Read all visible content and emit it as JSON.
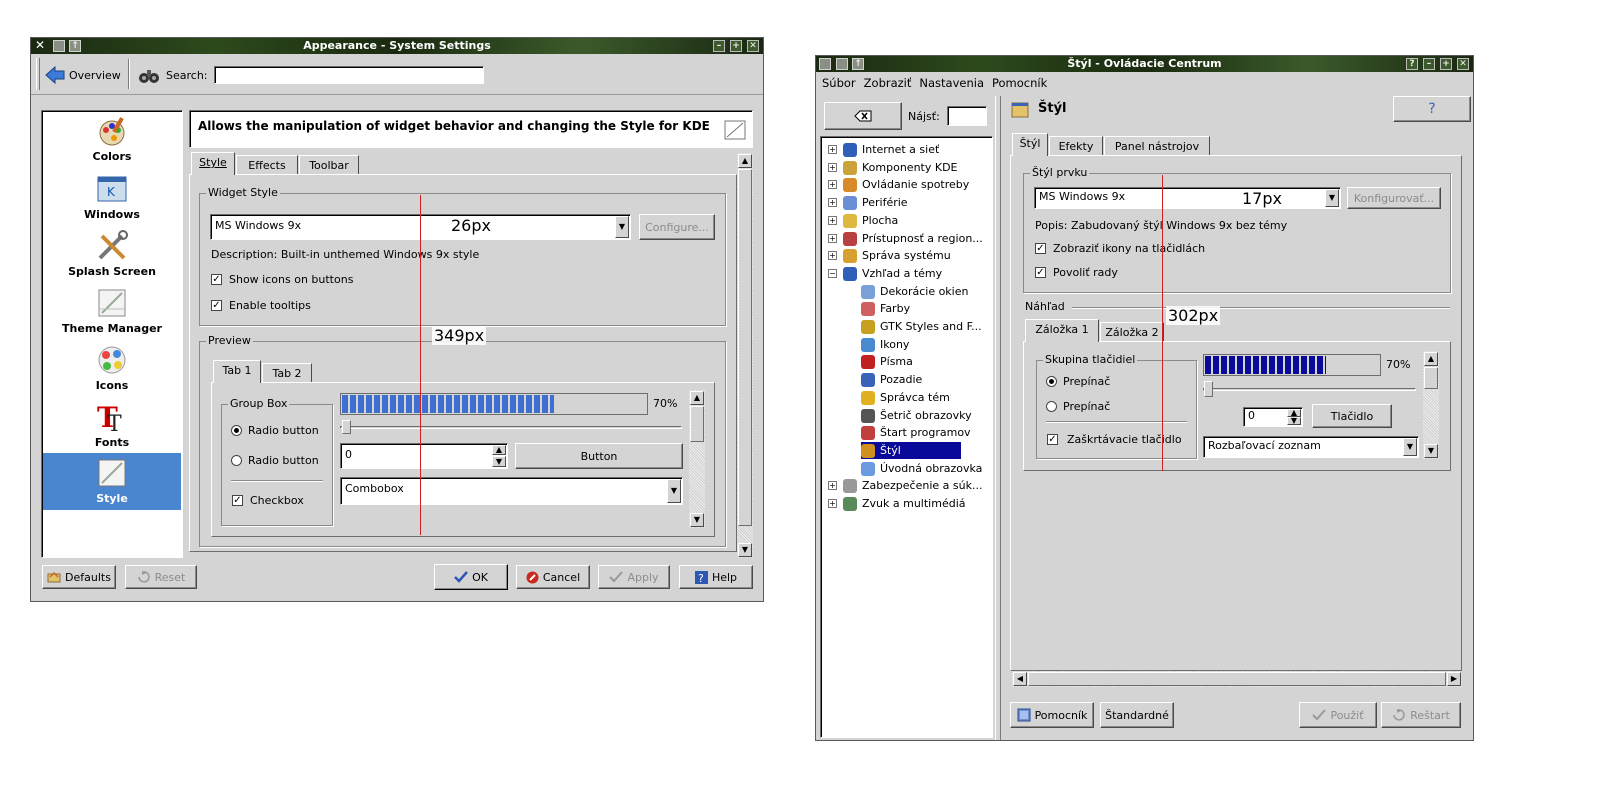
{
  "left_window": {
    "title": "Appearance - System Settings",
    "toolbar": {
      "overview_label": "Overview",
      "search_label": "Search:",
      "search_value": ""
    },
    "sidebar": {
      "items": [
        {
          "label": "Colors"
        },
        {
          "label": "Windows"
        },
        {
          "label": "Splash Screen"
        },
        {
          "label": "Theme Manager"
        },
        {
          "label": "Icons"
        },
        {
          "label": "Fonts"
        },
        {
          "label": "Style",
          "selected": true
        }
      ]
    },
    "header_text": "Allows the manipulation of widget behavior and changing the Style for KDE",
    "tabs": [
      "Style",
      "Effects",
      "Toolbar"
    ],
    "widget_style": {
      "group_title": "Widget Style",
      "combo_value": "MS Windows 9x",
      "configure_label": "Configure...",
      "description": "Description: Built-in unthemed Windows 9x style",
      "show_icons_label": "Show icons on buttons",
      "enable_tooltips_label": "Enable tooltips"
    },
    "preview": {
      "group_title": "Preview",
      "tabs": [
        "Tab 1",
        "Tab 2"
      ],
      "group_box_title": "Group Box",
      "radio1": "Radio button",
      "radio2": "Radio button",
      "checkbox": "Checkbox",
      "progress_percent": 70,
      "progress_label": "70%",
      "spin_value": "0",
      "button_label": "Button",
      "combobox_value": "Combobox"
    },
    "buttons": {
      "defaults": "Defaults",
      "reset": "Reset",
      "ok": "OK",
      "cancel": "Cancel",
      "apply": "Apply",
      "help": "Help"
    },
    "measure_26": "26px",
    "measure_349": "349px"
  },
  "right_window": {
    "title": "Štýl - Ovládacie Centrum",
    "menu": [
      "Súbor",
      "Zobraziť",
      "Nastavenia",
      "Pomocník"
    ],
    "find_label": "Nájsť:",
    "find_value": "",
    "tree": [
      {
        "label": "Internet a sieť",
        "level": 0
      },
      {
        "label": "Komponenty KDE",
        "level": 0
      },
      {
        "label": "Ovládanie spotreby",
        "level": 0
      },
      {
        "label": "Periférie",
        "level": 0
      },
      {
        "label": "Plocha",
        "level": 0
      },
      {
        "label": "Prístupnosť a region...",
        "level": 0
      },
      {
        "label": "Správa systému",
        "level": 0
      },
      {
        "label": "Vzhľad a témy",
        "level": 0,
        "expanded": true
      },
      {
        "label": "Dekorácie okien",
        "level": 1
      },
      {
        "label": "Farby",
        "level": 1
      },
      {
        "label": "GTK Styles and F...",
        "level": 1
      },
      {
        "label": "Ikony",
        "level": 1
      },
      {
        "label": "Písma",
        "level": 1
      },
      {
        "label": "Pozadie",
        "level": 1
      },
      {
        "label": "Správca tém",
        "level": 1
      },
      {
        "label": "Šetrič obrazovky",
        "level": 1
      },
      {
        "label": "Štart programov",
        "level": 1
      },
      {
        "label": "Štýl",
        "level": 1,
        "selected": true
      },
      {
        "label": "Úvodná obrazovka",
        "level": 1
      },
      {
        "label": "Zabezpečenie a súk...",
        "level": 0
      },
      {
        "label": "Zvuk a multimédiá",
        "level": 0
      }
    ],
    "page_title": "Štýl",
    "help_icon": "?",
    "tabs": [
      "Štýl",
      "Efekty",
      "Panel nástrojov"
    ],
    "style_group": {
      "title": "Štýl prvku",
      "combo_value": "MS Windows 9x",
      "configure_label": "Konfigurovať...",
      "description": "Popis: Zabudovaný štýl Windows 9x bez témy",
      "show_icons_label": "Zobraziť ikony na tlačidlách",
      "tooltips_label": "Povoliť rady"
    },
    "preview": {
      "title": "Náhľad",
      "tabs": [
        "Záložka 1",
        "Záložka 2"
      ],
      "group_title": "Skupina tlačidiel",
      "radio1": "Prepínač",
      "radio2": "Prepínač",
      "checkbox": "Zaškrtávacie tlačidlo",
      "progress_percent": 70,
      "progress_label": "70%",
      "spin_value": "0",
      "button_label": "Tlačidlo",
      "combo_value": "Rozbaľovací zoznam"
    },
    "buttons": {
      "help": "Pomocník",
      "defaults": "Štandardné",
      "apply": "Použiť",
      "reset": "Reštart"
    },
    "measure_17": "17px",
    "measure_302": "302px"
  }
}
